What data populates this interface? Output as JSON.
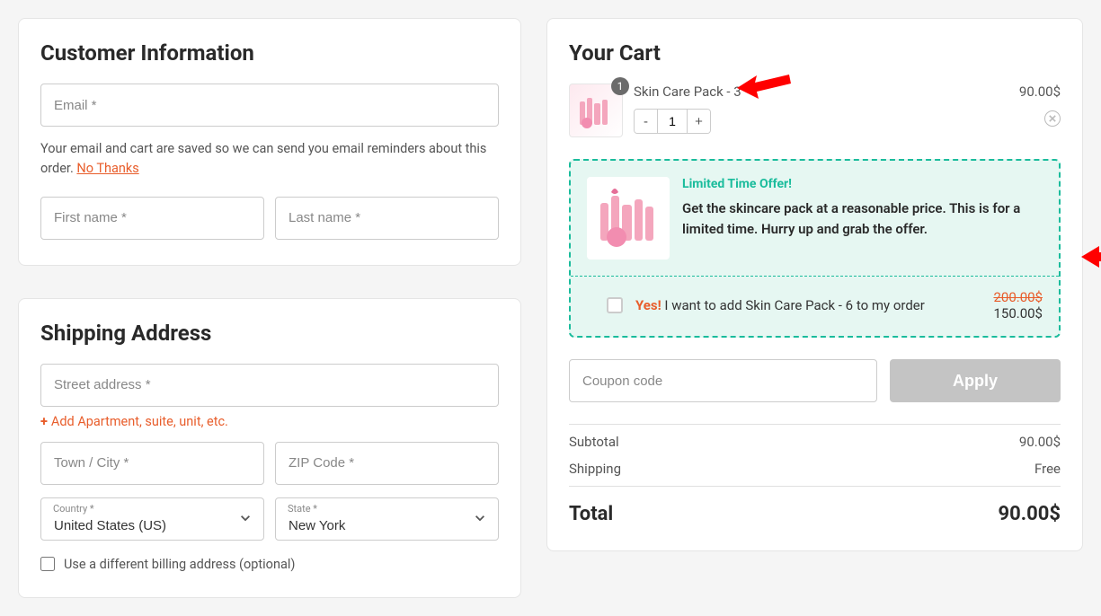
{
  "customer": {
    "heading": "Customer Information",
    "email_placeholder": "Email *",
    "note_text_before": "Your email and cart are saved so we can send you email reminders about this order. ",
    "note_link": "No Thanks",
    "firstname_placeholder": "First name *",
    "lastname_placeholder": "Last name *"
  },
  "shipping": {
    "heading": "Shipping Address",
    "street_placeholder": "Street address *",
    "add_apartment": "Add Apartment, suite, unit, etc.",
    "town_placeholder": "Town / City *",
    "zip_placeholder": "ZIP Code *",
    "country_label": "Country *",
    "country_value": "United States (US)",
    "state_label": "State *",
    "state_value": "New York",
    "diff_billing": "Use a different billing address (optional)"
  },
  "cart": {
    "heading": "Your Cart",
    "item": {
      "name": "Skin Care Pack - 3",
      "qty_badge": "1",
      "qty_value": "1",
      "price": "90.00$"
    },
    "offer": {
      "title": "Limited Time Offer!",
      "desc": "Get the skincare pack at a reasonable price. This is for a limited time. Hurry up and grab the offer.",
      "yes": "Yes!",
      "label": " I want to add Skin Care Pack - 6 to my order",
      "old_price": "200.00$",
      "new_price": "150.00$"
    },
    "coupon_placeholder": "Coupon code",
    "apply_label": "Apply",
    "subtotal_label": "Subtotal",
    "subtotal_value": "90.00$",
    "shipping_label": "Shipping",
    "shipping_value": "Free",
    "total_label": "Total",
    "total_value": "90.00$"
  }
}
